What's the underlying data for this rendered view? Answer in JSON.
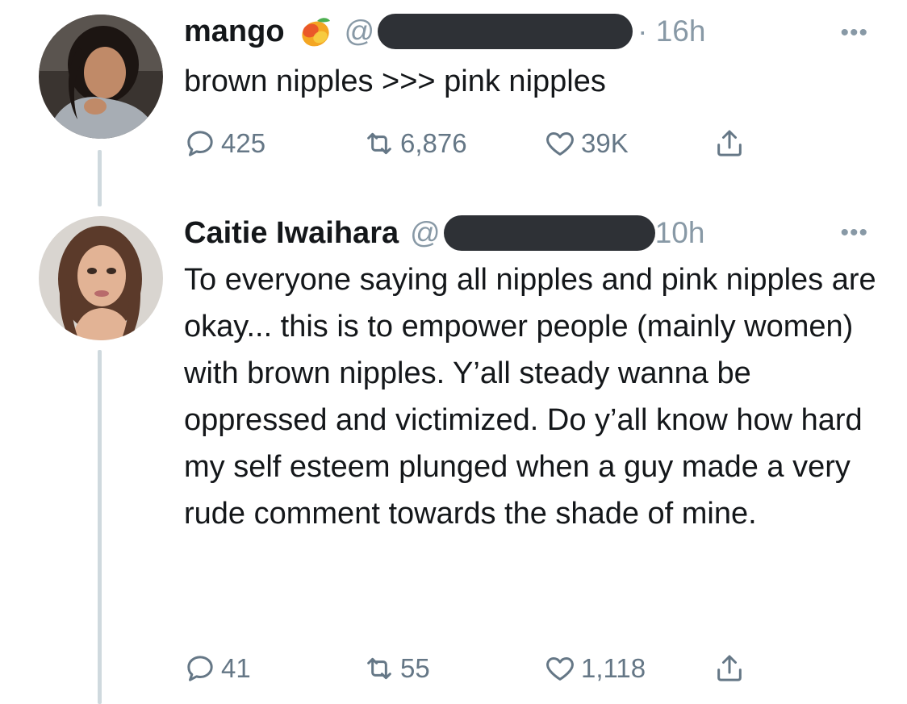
{
  "tweets": [
    {
      "name": "mango",
      "handle_prefix": "@",
      "time": "16h",
      "more": "•••",
      "text": "brown nipples >>> pink nipples",
      "replies": "425",
      "retweets": "6,876",
      "likes": "39K",
      "emoji_icon": "mango-emoji"
    },
    {
      "name": "Caitie Iwaihara",
      "handle_prefix": "@",
      "time": "10h",
      "more": "•••",
      "text": "To everyone saying all nipples and pink nipples are okay... this is to empower people (mainly women) with brown nipples. Y’all steady wanna be oppressed and victimized. Do y’all know how hard my self esteem plunged when a guy made a very rude comment towards the shade of mine.",
      "replies": "41",
      "retweets": "55",
      "likes": "1,118"
    }
  ],
  "colors": {
    "text": "#14171a",
    "secondary": "#8899a6",
    "action": "#657786",
    "thread_line": "#cfd9de",
    "redaction": "#2e3136"
  }
}
